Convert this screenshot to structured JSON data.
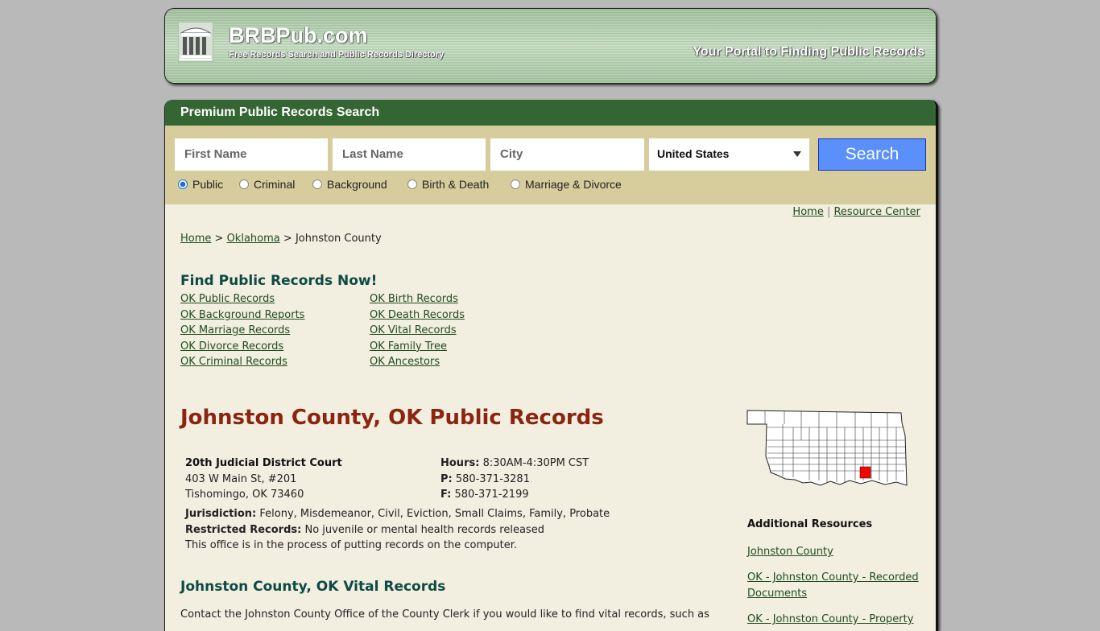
{
  "header": {
    "brand": "BRBPub.com",
    "tagline": "Free Records Search and Public Records Directory",
    "portal_tagline": "Your Portal to Finding Public Records"
  },
  "search": {
    "title": "Premium Public Records Search",
    "first_name_placeholder": "First Name",
    "last_name_placeholder": "Last Name",
    "city_placeholder": "City",
    "country_selected": "United States",
    "button_label": "Search",
    "record_types": [
      {
        "label": "Public",
        "selected": true
      },
      {
        "label": "Criminal",
        "selected": false
      },
      {
        "label": "Background",
        "selected": false
      },
      {
        "label": "Birth & Death",
        "selected": false
      },
      {
        "label": "Marriage & Divorce",
        "selected": false
      }
    ]
  },
  "top_links": {
    "home": "Home",
    "separator": "|",
    "resource_center": "Resource Center"
  },
  "breadcrumb": {
    "home": "Home",
    "sep": ">",
    "state": "Oklahoma",
    "current": "Johnston County"
  },
  "find": {
    "title": "Find Public Records Now!",
    "col1": [
      "OK Public Records",
      "OK Background Reports",
      "OK Marriage Records",
      "OK Divorce Records",
      "OK Criminal Records"
    ],
    "col2": [
      "OK Birth Records",
      "OK Death Records",
      "OK Vital Records",
      "OK Family Tree",
      "OK Ancestors"
    ]
  },
  "main": {
    "title": "Johnston County, OK Public Records",
    "court": {
      "name": "20th Judicial District Court",
      "address1": "403 W Main St, #201",
      "address2": "Tishomingo, OK 73460",
      "hours_label": "Hours:",
      "hours": "8:30AM-4:30PM CST",
      "phone_label": "P:",
      "phone": "580-371-3281",
      "fax_label": "F:",
      "fax": "580-371-2199",
      "jurisdiction_label": "Jurisdiction:",
      "jurisdiction": "Felony, Misdemeanor, Civil, Eviction, Small Claims, Family, Probate",
      "restricted_label": "Restricted Records:",
      "restricted": "No juvenile or mental health records released",
      "note": "This office is in the process of putting records on the computer."
    },
    "vital_title": "Johnston County, OK Vital Records",
    "vital_text": "Contact the Johnston County Office of the County Clerk if you would like to find vital records, such as"
  },
  "sidebar": {
    "map_highlight_color": "#ff0000",
    "additional_title": "Additional Resources",
    "links": [
      "Johnston County",
      "OK - Johnston County - Recorded Documents",
      "OK - Johnston County - Property"
    ]
  }
}
